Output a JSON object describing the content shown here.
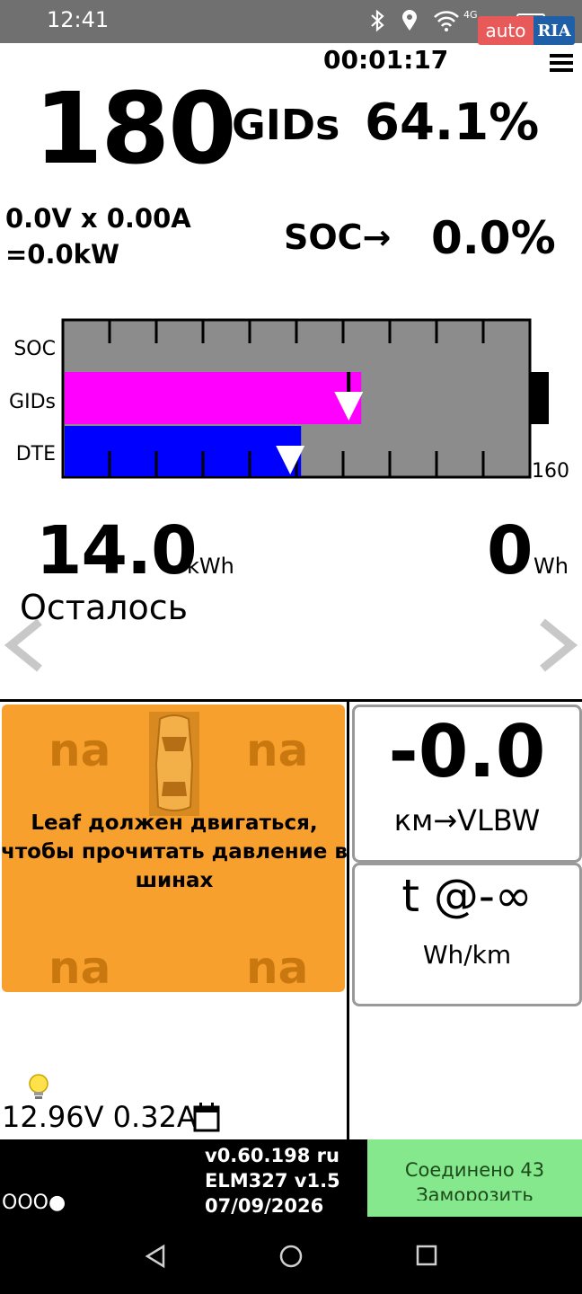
{
  "status_bar": {
    "time": "12:41",
    "network": "4G",
    "icons": [
      "bluetooth-icon",
      "location-icon",
      "wifi-icon",
      "battery-icon"
    ],
    "watermark": "autoRIA"
  },
  "header": {
    "timer": "00:01:17",
    "menu_icon": "hamburger-menu-icon"
  },
  "gids": {
    "value": "180",
    "unit": "GIDs",
    "percent": "64.1%"
  },
  "power": {
    "line1": "0.0V x 0.00A",
    "line2": "=0.0kW"
  },
  "soc": {
    "label": "SOC→",
    "value": "0.0%"
  },
  "battery_gauge": {
    "labels": [
      "SOC",
      "GIDs",
      "DTE"
    ],
    "max_label": "160",
    "gids_fill_fraction": 0.64,
    "dte_fill_fraction": 0.51,
    "colors": {
      "background": "#8c8c8c",
      "gids": "#ff00ff",
      "dte": "#0000ff"
    }
  },
  "energy": {
    "remaining_value": "14.0",
    "remaining_unit": "kWh",
    "used_value": "0",
    "used_unit": "Wh",
    "remaining_label": "Осталось"
  },
  "tires": {
    "front_left": "na",
    "front_right": "na",
    "rear_left": "na",
    "rear_right": "na",
    "message": "Leaf должен двигаться, чтобы прочитать давление в шинах",
    "color": "#f7a02d"
  },
  "range": {
    "value": "-0.0",
    "label": "км→VLBW"
  },
  "efficiency": {
    "value": "t @-∞",
    "label": "Wh/km"
  },
  "aux_battery": {
    "readout": "12.96V 0.32A"
  },
  "footer": {
    "dots": "OOO●",
    "version": "v0.60.198 ru",
    "adapter": "ELM327 v1.5",
    "date": "07/09/2026",
    "connect_status": "Соединено 43",
    "connect_action": "Заморозить",
    "connect_color": "#86e88c"
  }
}
